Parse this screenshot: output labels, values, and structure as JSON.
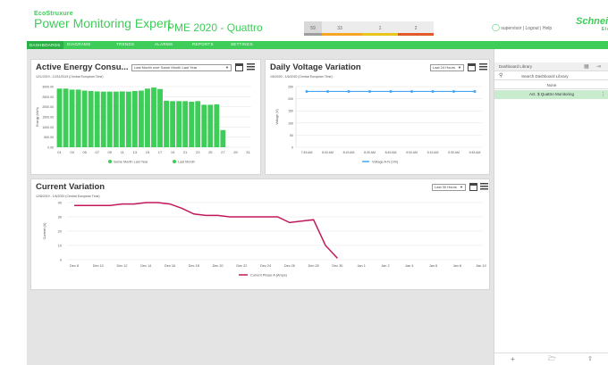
{
  "header": {
    "brand_top": "EcoStruxure",
    "brand_title": "Power Monitoring Expert",
    "product": "PME 2020 - Quattro",
    "alarms": [
      {
        "label": "59",
        "color": "#9e9e9e"
      },
      {
        "label": "33",
        "color": "#f5a623"
      },
      {
        "label": "1",
        "color": "#e05a2a"
      },
      {
        "label": "2",
        "color": "#d0021b"
      }
    ],
    "user_text": "supervisor | Logout | Help",
    "logo_main": "Schneider",
    "logo_sub": "Electric"
  },
  "nav": {
    "items": [
      "DASHBOARDS",
      "DIAGRAMS",
      "TRENDS",
      "ALARMS",
      "REPORTS",
      "SETTINGS"
    ]
  },
  "cards": {
    "energy": {
      "title": "Active Energy Consu...",
      "subtitle": "12/1/2019 - 12/31/2019 (Central European Time)",
      "dropdown": "Last Month over Same Month Last Year",
      "ylabel": "Energy (kWh)"
    },
    "voltage": {
      "title": "Daily Voltage Variation",
      "subtitle": "1/6/2020 - 1/6/2020 (Central European Time)",
      "dropdown": "Last 24 Hours",
      "ylabel": "Voltage (V)"
    },
    "current": {
      "title": "Current Variation",
      "subtitle": "12/8/2019 - 1/6/2020 (Central European Time)",
      "dropdown": "Last 30 Hours",
      "ylabel": "Current (A)"
    }
  },
  "right_panel": {
    "title": "Dashboard Library",
    "search_placeholder": "Search Dashboard Library",
    "none_label": "None",
    "selected_item": "Act. $ Quattro Monitoring"
  },
  "chart_data": [
    {
      "type": "bar",
      "title": "Active Energy Consu...",
      "ylabel": "Energy (kWh)",
      "ylim": [
        0,
        3000
      ],
      "yticks": [
        0,
        500,
        1000,
        1500,
        2000,
        2500,
        3000
      ],
      "categories": [
        "01",
        "02",
        "03",
        "04",
        "05",
        "06",
        "07",
        "08",
        "09",
        "10",
        "11",
        "12",
        "13",
        "14",
        "15",
        "16",
        "17",
        "18",
        "19",
        "20",
        "21",
        "22",
        "23",
        "24",
        "25",
        "26",
        "27",
        "28",
        "29",
        "30",
        "31"
      ],
      "tick_labels": [
        "01",
        "03",
        "05",
        "07",
        "09",
        "11",
        "13",
        "15",
        "17",
        "19",
        "21",
        "23",
        "25",
        "27",
        "29",
        "31"
      ],
      "series": [
        {
          "name": "Same Month Last Year",
          "color": "#3dcd58",
          "values": [
            2900,
            2900,
            2850,
            2850,
            2800,
            2780,
            2760,
            2750,
            2750,
            2750,
            2760,
            2750,
            2780,
            2800,
            2900,
            2950,
            2880,
            2300,
            2280,
            2280,
            2280,
            2250,
            2280,
            2100,
            2100,
            2120,
            850,
            0,
            0,
            0,
            0
          ]
        },
        {
          "name": "Last Month",
          "color": "#3dcd58",
          "values": []
        }
      ],
      "legend_position": "bottom"
    },
    {
      "type": "line",
      "title": "Daily Voltage Variation",
      "ylabel": "Voltage (V)",
      "ylim": [
        0,
        250
      ],
      "yticks": [
        0,
        50,
        100,
        150,
        200,
        250
      ],
      "x": [
        "7:45 AM",
        "8:00 AM",
        "8:15 AM",
        "8:30 AM",
        "8:45 AM",
        "9:00 AM",
        "9:15 AM",
        "9:30 AM",
        "9:45 AM"
      ],
      "series": [
        {
          "name": "Voltage A-N (Vln)",
          "color": "#42a5f5",
          "values": [
            230,
            230,
            230,
            230,
            230,
            230,
            230,
            230,
            230
          ]
        }
      ],
      "legend_position": "bottom"
    },
    {
      "type": "line",
      "title": "Current Variation",
      "ylabel": "Current (A)",
      "ylim": [
        0,
        40
      ],
      "yticks": [
        0,
        10,
        20,
        30,
        40
      ],
      "x": [
        "Dec 8",
        "Dec 10",
        "Dec 12",
        "Dec 14",
        "Dec 16",
        "Dec 18",
        "Dec 20",
        "Dec 22",
        "Dec 24",
        "Dec 26",
        "Dec 28",
        "Dec 30",
        "Jan 1",
        "Jan 2",
        "Jan 4",
        "Jan 6",
        "Jan 8",
        "Jan 10"
      ],
      "series": [
        {
          "name": "Current Phase A (Amps)",
          "color": "#c2185b",
          "points": [
            [
              0,
              38
            ],
            [
              2,
              38
            ],
            [
              3,
              38
            ],
            [
              4,
              39
            ],
            [
              5,
              39
            ],
            [
              6,
              40
            ],
            [
              7,
              40
            ],
            [
              8,
              39
            ],
            [
              9,
              36
            ],
            [
              10,
              32
            ],
            [
              11,
              31
            ],
            [
              12,
              31
            ],
            [
              13,
              30
            ],
            [
              14,
              30
            ],
            [
              15,
              30
            ],
            [
              16,
              30
            ],
            [
              17,
              30
            ],
            [
              18,
              26
            ],
            [
              19,
              27
            ],
            [
              20,
              28
            ],
            [
              21,
              10
            ],
            [
              22,
              1
            ]
          ]
        }
      ],
      "x_step_days": 2,
      "legend_position": "bottom"
    }
  ]
}
